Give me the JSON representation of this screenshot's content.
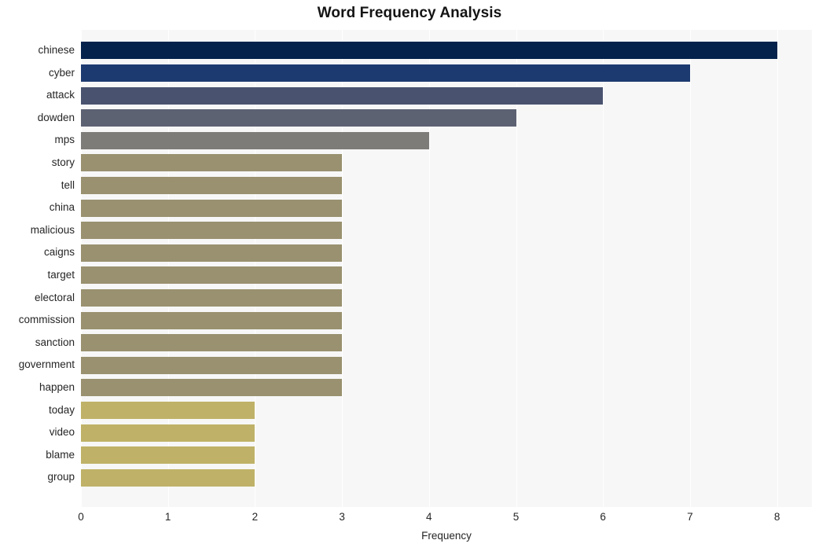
{
  "chart_data": {
    "type": "bar",
    "orientation": "horizontal",
    "title": "Word Frequency Analysis",
    "xlabel": "Frequency",
    "ylabel": "",
    "xlim": [
      0,
      8
    ],
    "xticks": [
      0,
      1,
      2,
      3,
      4,
      5,
      6,
      7,
      8
    ],
    "xtick_labels": [
      "0",
      "1",
      "2",
      "3",
      "4",
      "5",
      "6",
      "7",
      "8"
    ],
    "grid": "vertical-white",
    "legend": "none",
    "background": "#f7f7f7",
    "categories": [
      "chinese",
      "cyber",
      "attack",
      "dowden",
      "mps",
      "story",
      "tell",
      "china",
      "malicious",
      "caigns",
      "target",
      "electoral",
      "commission",
      "sanction",
      "government",
      "happen",
      "today",
      "video",
      "blame",
      "group"
    ],
    "values": [
      8,
      7,
      6,
      5,
      4,
      3,
      3,
      3,
      3,
      3,
      3,
      3,
      3,
      3,
      3,
      3,
      2,
      2,
      2,
      2
    ],
    "bar_colors": [
      "#04224c",
      "#1d3a70",
      "#49536f",
      "#5c6272",
      "#7d7c78",
      "#99916f",
      "#99916f",
      "#99916f",
      "#99916f",
      "#99916f",
      "#99916f",
      "#99916f",
      "#99916f",
      "#99916f",
      "#99916f",
      "#99916f",
      "#bfb268",
      "#bfb268",
      "#bfb268",
      "#bfb268"
    ]
  }
}
